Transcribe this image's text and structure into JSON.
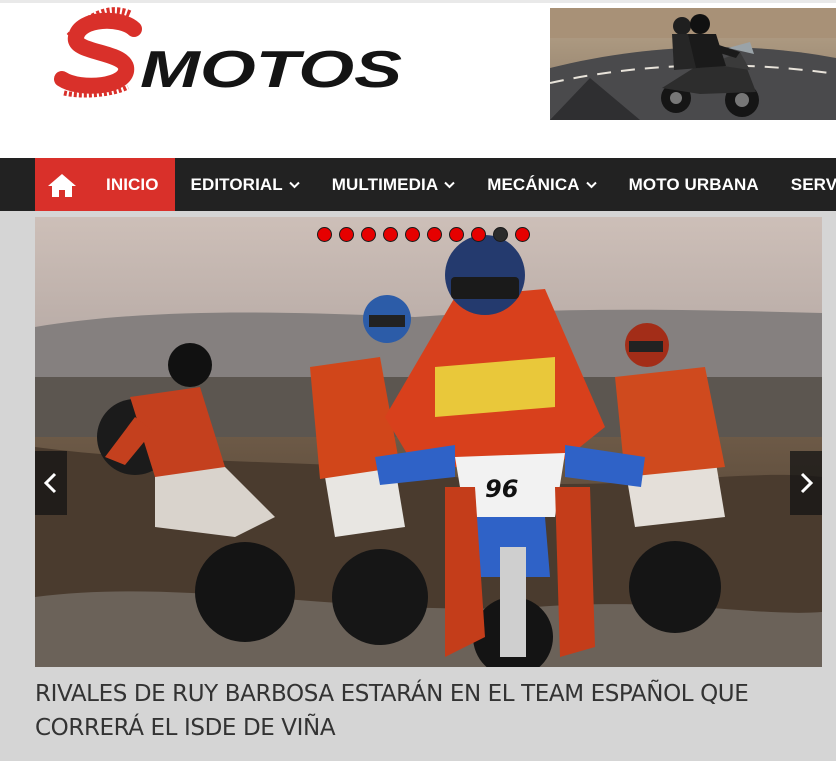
{
  "site": {
    "logo_text": "SMOTOS",
    "logo_letter": "S",
    "logo_rest": "MOTOS"
  },
  "ad": {
    "alt": "motorcycle-riders-ad"
  },
  "nav": {
    "home_icon": "home-icon",
    "items": [
      {
        "label": "INICIO",
        "active": true,
        "has_dropdown": false
      },
      {
        "label": "EDITORIAL",
        "active": false,
        "has_dropdown": true
      },
      {
        "label": "MULTIMEDIA",
        "active": false,
        "has_dropdown": true
      },
      {
        "label": "MECÁNICA",
        "active": false,
        "has_dropdown": true
      },
      {
        "label": "MOTO URBANA",
        "active": false,
        "has_dropdown": false
      },
      {
        "label": "SERVI",
        "active": false,
        "has_dropdown": false
      }
    ]
  },
  "slider": {
    "dot_count": 10,
    "active_dot": 8,
    "prev_icon": "chevron-left-icon",
    "next_icon": "chevron-right-icon",
    "image_description": "enduro-riders-slide"
  },
  "article": {
    "headline": "RIVALES DE RUY BARBOSA ESTARÁN EN EL TEAM ESPAÑOL QUE CORRERÁ EL ISDE DE VIÑA"
  },
  "colors": {
    "accent": "#d9302a",
    "navbar": "#222222",
    "dot": "#e60000",
    "dot_active": "#2b2b2b",
    "page_bg": "#d5d5d5"
  }
}
